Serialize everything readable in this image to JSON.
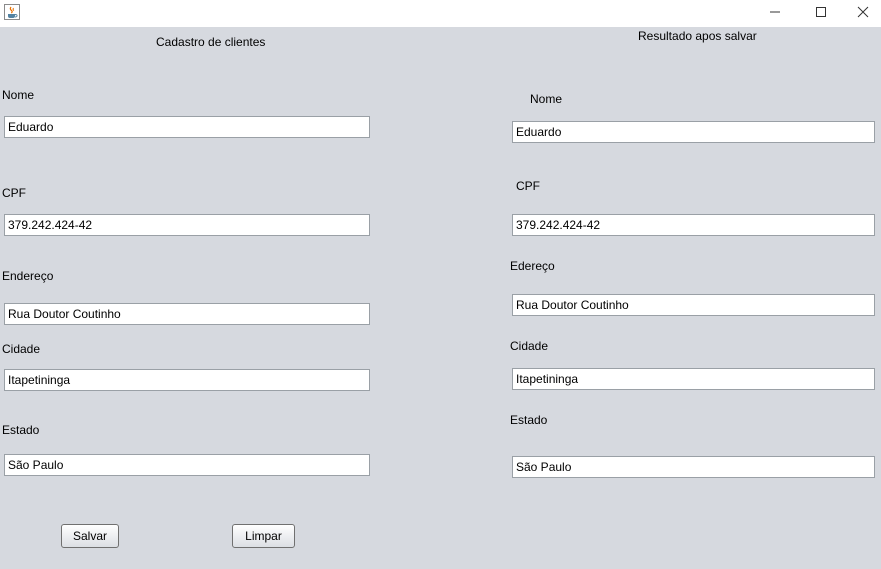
{
  "window": {
    "icon": "java-cup-icon",
    "controls": [
      "minimize-icon",
      "maximize-icon",
      "close-icon"
    ]
  },
  "form": {
    "title": "Cadastro de clientes",
    "nome_label": "Nome",
    "nome_value": "Eduardo",
    "cpf_label": "CPF",
    "cpf_value": "379.242.424-42",
    "endereco_label": "Endereço",
    "endereco_value": "Rua Doutor Coutinho",
    "cidade_label": "Cidade",
    "cidade_value": "Itapetininga",
    "estado_label": "Estado",
    "estado_value": "São Paulo",
    "save_label": "Salvar",
    "clear_label": "Limpar"
  },
  "result": {
    "title": "Resultado apos salvar",
    "nome_label": "Nome",
    "nome_value": "Eduardo",
    "cpf_label": "CPF",
    "cpf_value": "379.242.424-42",
    "endereco_label": "Edereço",
    "endereco_value": "Rua Doutor Coutinho",
    "cidade_label": "Cidade",
    "cidade_value": "Itapetininga",
    "estado_label": "Estado",
    "estado_value": "São Paulo"
  }
}
